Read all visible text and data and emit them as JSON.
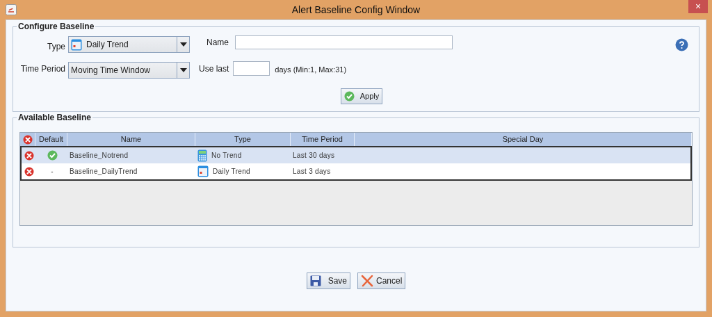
{
  "window": {
    "title": "Alert Baseline Config Window",
    "close": "×"
  },
  "configure": {
    "title": "Configure Baseline",
    "type": {
      "label": "Type",
      "value": "Daily Trend",
      "kind": "daily_trend"
    },
    "time_period": {
      "label": "Time Period",
      "value": "Moving Time Window"
    },
    "name": {
      "label": "Name"
    },
    "use_last": {
      "label": "Use last",
      "hint": "days (Min:1, Max:31)"
    },
    "apply": "Apply"
  },
  "available": {
    "title": "Available Baseline",
    "columns": [
      "Default",
      "Name",
      "Type",
      "Time Period",
      "Special Day"
    ],
    "rows": [
      {
        "selected": true,
        "is_default": true,
        "name": "Baseline_Notrend",
        "type": "No Trend",
        "kind": "no_trend",
        "time_period": "Last 30 days"
      },
      {
        "selected": false,
        "is_default": false,
        "default_text": "-",
        "name": "Baseline_DailyTrend",
        "type": "Daily Trend",
        "kind": "daily_trend",
        "time_period": "Last 3 days"
      }
    ]
  },
  "buttons": {
    "save": "Save",
    "cancel": "Cancel"
  }
}
